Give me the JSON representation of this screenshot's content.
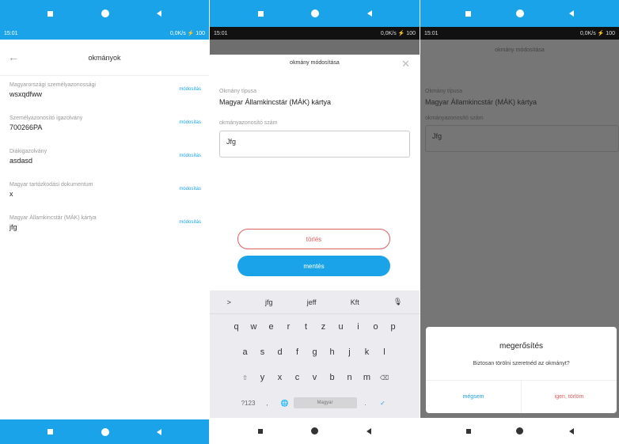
{
  "status": {
    "time": "15:01",
    "right": "0,0K/s ⚡ 100"
  },
  "panel1": {
    "title": "okmányok",
    "items": [
      {
        "label": "Magyarországi személyazonossági",
        "value": "wsxqdfww",
        "edit": "módosítás"
      },
      {
        "label": "Személyazonosító igazolvány",
        "value": "700266PA",
        "edit": "módosítás"
      },
      {
        "label": "Diákigazolvány",
        "value": "asdasd",
        "edit": "módosítás"
      },
      {
        "label": "Magyar tartózkodási dokumentum",
        "value": "x",
        "edit": "módosítás"
      },
      {
        "label": "Magyar Államkincstár (MÁK) kártya",
        "value": "jfg",
        "edit": "módosítás"
      }
    ]
  },
  "panel2": {
    "title": "okmány módosítása",
    "type_label": "Okmány típusa",
    "type_value": "Magyar Államkincstár (MÁK) kártya",
    "id_label": "okmányazonosító szám",
    "id_value": "Jfg",
    "delete_label": "törlés",
    "save_label": "mentés",
    "keyboard": {
      "suggestions": [
        ">",
        "jfg",
        "jeff",
        "Kft",
        "🎙"
      ],
      "row1": [
        "q",
        "w",
        "e",
        "r",
        "t",
        "z",
        "u",
        "i",
        "o",
        "p"
      ],
      "row2": [
        "a",
        "s",
        "d",
        "f",
        "g",
        "h",
        "j",
        "k",
        "l"
      ],
      "row3": [
        "⇧",
        "y",
        "x",
        "c",
        "v",
        "b",
        "n",
        "m",
        "⌫"
      ],
      "row4": {
        "sym": "?123",
        "comma": ",",
        "globe": "🌐",
        "space": "Magyar",
        "period": ".",
        "enter": "✓"
      }
    }
  },
  "panel3": {
    "title": "okmány módosítása",
    "type_label": "Okmány típusa",
    "type_value": "Magyar Államkincstár (MÁK) kártya",
    "id_label": "okmányazonosító szám",
    "id_value": "Jfg",
    "dialog": {
      "title": "megerősítés",
      "message": "Biztosan törölni szeretnéd az okmányt?",
      "cancel": "mégsem",
      "confirm": "igen, törlöm"
    }
  }
}
